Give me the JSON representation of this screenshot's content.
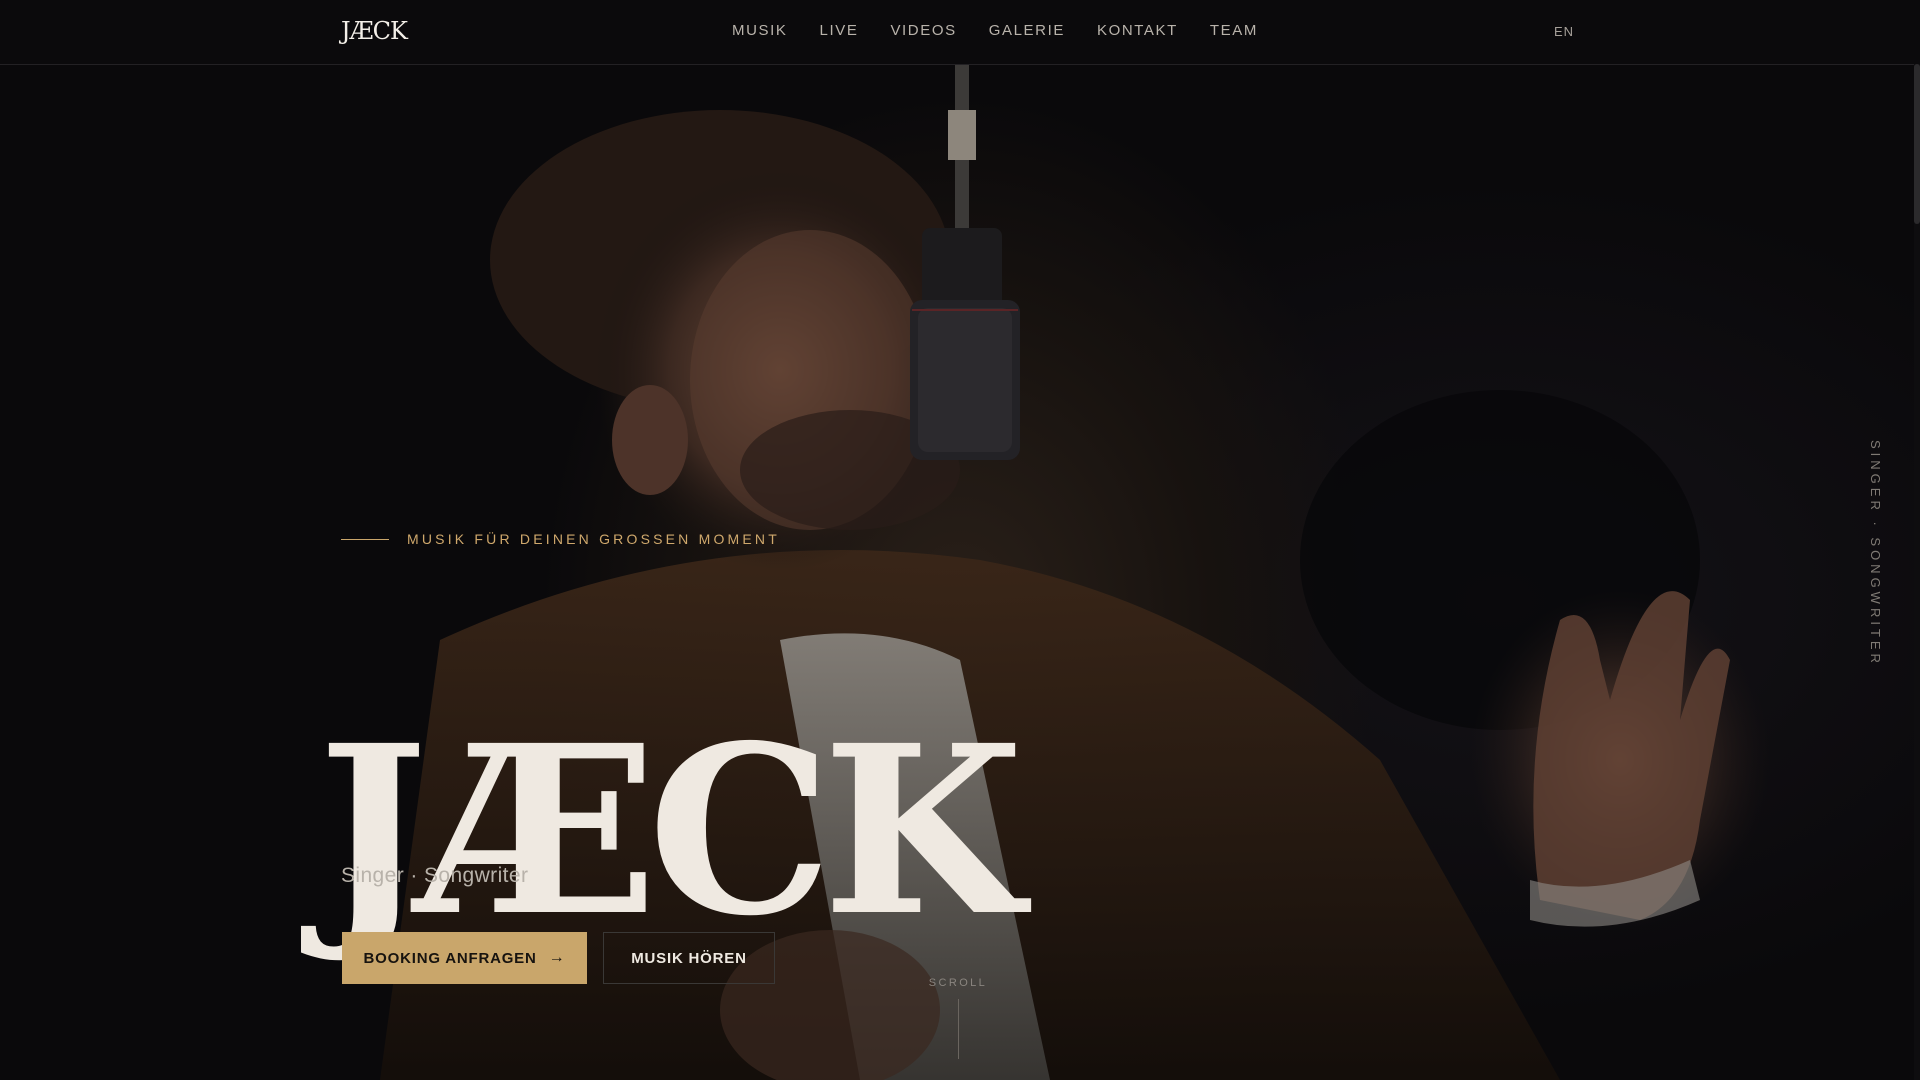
{
  "brand": {
    "logo": "JÆCK"
  },
  "nav": {
    "items": [
      {
        "label": "MUSIK"
      },
      {
        "label": "LIVE"
      },
      {
        "label": "VIDEOS"
      },
      {
        "label": "GALERIE"
      },
      {
        "label": "KONTAKT"
      },
      {
        "label": "TEAM"
      }
    ],
    "language": "EN"
  },
  "hero": {
    "eyebrow": "MUSIK FÜR DEINEN GROSSEN MOMENT",
    "title": "JÆCK",
    "subtitle": "Singer · Songwriter",
    "primary_button": "BOOKING ANFRAGEN",
    "primary_icon": "arrow-right-icon",
    "secondary_button": "MUSIK HÖREN",
    "scroll_label": "SCROLL",
    "side_label": "SINGER · SONGWRITER"
  },
  "colors": {
    "accent_gold": "#c9a66b",
    "background": "#0b0a0c",
    "text_primary": "#efe9e1",
    "text_muted": "#b8b2aa"
  }
}
